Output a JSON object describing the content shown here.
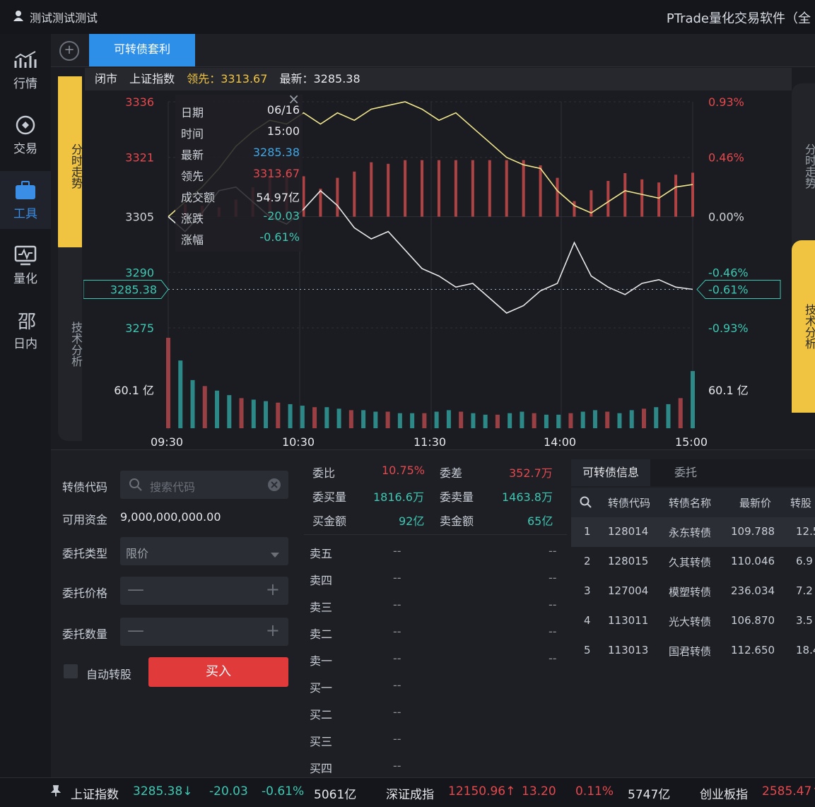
{
  "titlebar": {
    "user": "测试测试测试",
    "app_title": "PTrade量化交易软件（全"
  },
  "nav": [
    {
      "label": "行情",
      "icon": "chart-icon"
    },
    {
      "label": "交易",
      "icon": "trade-icon"
    },
    {
      "label": "工具",
      "icon": "toolbox-icon"
    },
    {
      "label": "量化",
      "icon": "monitor-icon"
    },
    {
      "label": "日内",
      "icon": "intraday-icon"
    }
  ],
  "tabbar": {
    "active_tab": "可转债套利"
  },
  "chart_info": {
    "status": "闭市",
    "index_name": "上证指数",
    "leader_label": "领先：3313.67",
    "latest_label": "最新：3285.38"
  },
  "side_tabs": {
    "left_top": "分时走势",
    "left_bottom": "技术分析",
    "right_top": "分时走势",
    "right_bottom": "技术分析"
  },
  "tooltip": {
    "rows": [
      {
        "k": "日期",
        "v": "06/16"
      },
      {
        "k": "时间",
        "v": "15:00"
      },
      {
        "k": "最新",
        "v": "3285.38"
      },
      {
        "k": "领先",
        "v": "3313.67"
      },
      {
        "k": "成交额",
        "v": "54.97亿"
      },
      {
        "k": "涨跌",
        "v": "-20.03"
      },
      {
        "k": "涨幅",
        "v": "-0.61%"
      }
    ]
  },
  "chart_data": {
    "type": "line",
    "y_left_ticks": [
      "3336",
      "3321",
      "3305",
      "3290",
      "3275"
    ],
    "y_right_ticks": [
      "0.93%",
      "0.46%",
      "0.00%",
      "-0.46%",
      "-0.93%"
    ],
    "current_price_label": "3285.38",
    "current_pct_label": "-0.61%",
    "volume_label": "60.1 亿",
    "x_ticks": [
      "09:30",
      "10:30",
      "11:30",
      "14:00",
      "15:00"
    ],
    "ylim": [
      3275,
      3336
    ],
    "series": [
      {
        "name": "领先",
        "values": [
          3305,
          3309,
          3313,
          3318,
          3324,
          3328,
          3331,
          3330,
          3333,
          3330,
          3333,
          3331,
          3334,
          3335,
          3336,
          3334,
          3331,
          3333,
          3329,
          3325,
          3321,
          3319,
          3318,
          3312,
          3308,
          3306,
          3309,
          3312,
          3311,
          3310,
          3313,
          3313.67
        ]
      },
      {
        "name": "最新",
        "values": [
          3305,
          3301,
          3306,
          3312,
          3313,
          3309,
          3305,
          3303,
          3307,
          3312,
          3308,
          3302,
          3299,
          3301,
          3296,
          3291,
          3289,
          3286,
          3287,
          3283,
          3279,
          3281,
          3285,
          3287,
          3298,
          3289,
          3286,
          3284,
          3287,
          3288,
          3286,
          3285.38
        ]
      }
    ],
    "volume_values": [
      60.1,
      45,
      32,
      28,
      25,
      22,
      20,
      19,
      18,
      17,
      16,
      15,
      14,
      14,
      13,
      12,
      12,
      11,
      11,
      10,
      10,
      10,
      11,
      12,
      11,
      10,
      9,
      9,
      10,
      11,
      10,
      9,
      9,
      10,
      11,
      12,
      11,
      10,
      12,
      13,
      14,
      16,
      20,
      38
    ]
  },
  "order_form": {
    "code_label": "转债代码",
    "search_placeholder": "搜索代码",
    "funds_label": "可用资金",
    "funds_value": "9,000,000,000.00",
    "type_label": "委托类型",
    "type_value": "限价",
    "price_label": "委托价格",
    "qty_label": "委托数量",
    "auto_convert_label": "自动转股",
    "buy_label": "买入"
  },
  "orderbook": {
    "stats": [
      {
        "k": "委比",
        "v": "10.75%"
      },
      {
        "k": "委差",
        "v": "352.7万"
      },
      {
        "k": "委买量",
        "v": "1816.6万"
      },
      {
        "k": "委卖量",
        "v": "1463.8万"
      },
      {
        "k": "买金额",
        "v": "92亿"
      },
      {
        "k": "卖金额",
        "v": "65亿"
      }
    ],
    "levels": [
      "卖五",
      "卖四",
      "卖三",
      "卖二",
      "卖一",
      "买一",
      "买二",
      "买三",
      "买四"
    ],
    "dash": "--"
  },
  "bond_info": {
    "tabs": [
      "可转债信息",
      "委托"
    ],
    "headers": [
      "转债代码",
      "转债名称",
      "最新价",
      "转股"
    ],
    "rows": [
      [
        "1",
        "128014",
        "永东转债",
        "109.788",
        "12.5"
      ],
      [
        "2",
        "128015",
        "久其转债",
        "110.046",
        "6.9"
      ],
      [
        "3",
        "127004",
        "模塑转债",
        "236.034",
        "7.2"
      ],
      [
        "4",
        "113011",
        "光大转债",
        "106.870",
        "3.5"
      ],
      [
        "5",
        "113013",
        "国君转债",
        "112.650",
        "18.4"
      ]
    ]
  },
  "statusbar": {
    "sh_name": "上证指数",
    "sh_price": "3285.38↓",
    "sh_chg": "-20.03",
    "sh_pct": "-0.61%",
    "sh_amt": "5061亿",
    "sz_name": "深证成指",
    "sz_price": "12150.96↑",
    "sz_chg": "13.20",
    "sz_pct": "0.11%",
    "sz_amt": "5747亿",
    "cy_name": "创业板指",
    "cy_price": "2585.47↑"
  },
  "colors": {
    "up": "#e5484d",
    "down": "#3ec7b3",
    "leader": "#f0e68c",
    "latest": "#e8e8e8",
    "accent": "#2e8fe8",
    "tab_yellow": "#f0c340"
  }
}
